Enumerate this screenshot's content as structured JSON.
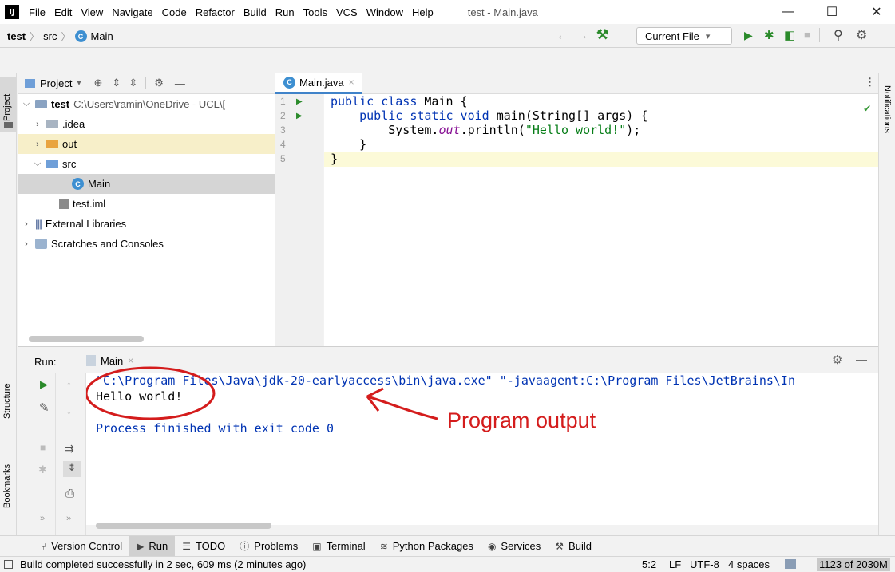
{
  "menu": {
    "items": [
      "File",
      "Edit",
      "View",
      "Navigate",
      "Code",
      "Refactor",
      "Build",
      "Run",
      "Tools",
      "VCS",
      "Window",
      "Help"
    ],
    "window_title": "test - Main.java",
    "logo_text": "IJ"
  },
  "window_controls": {
    "minimize": "—",
    "maximize": "☐",
    "close": "✕"
  },
  "breadcrumb": {
    "project": "test",
    "folder": "src",
    "file": "Main"
  },
  "run_config": {
    "label": "Current File",
    "arrow": "▾"
  },
  "side_labels": {
    "project": "Project",
    "structure": "Structure",
    "bookmarks": "Bookmarks",
    "notifications": "Notifications"
  },
  "project_panel": {
    "title": "Project",
    "tree": {
      "root_name": "test",
      "root_path": "C:\\Users\\ramin\\OneDrive - UCL\\[",
      "idea": ".idea",
      "out": "out",
      "src": "src",
      "main": "Main",
      "iml": "test.iml",
      "external": "External Libraries",
      "scratches": "Scratches and Consoles"
    }
  },
  "editor": {
    "tab_label": "Main.java",
    "line_numbers": [
      "1",
      "2",
      "3",
      "4",
      "5"
    ],
    "code": {
      "l1_kw": "public class ",
      "l1_rest": "Main {",
      "l2_kw": "    public static void ",
      "l2_rest": "main(String[] args) {",
      "l3_pre": "        System.",
      "l3_field": "out",
      "l3_mid": ".println(",
      "l3_str": "\"Hello world!\"",
      "l3_end": ");",
      "l4": "    }",
      "l5": "}"
    }
  },
  "run_panel": {
    "label": "Run:",
    "tab": "Main",
    "console": {
      "cmd": "\"C:\\Program Files\\Java\\jdk-20-earlyaccess\\bin\\java.exe\" \"-javaagent:C:\\Program Files\\JetBrains\\In",
      "output": "Hello world!",
      "exit": "Process finished with exit code 0"
    },
    "annotation": "Program output"
  },
  "tool_windows": [
    "Version Control",
    "Run",
    "TODO",
    "Problems",
    "Terminal",
    "Python Packages",
    "Services",
    "Build"
  ],
  "status": {
    "message": "Build completed successfully in 2 sec, 609 ms (2 minutes ago)",
    "position": "5:2",
    "line_sep": "LF",
    "encoding": "UTF-8",
    "indent": "4 spaces",
    "memory": "1123 of 2030M"
  },
  "colors": {
    "accent": "#4083c9",
    "annotation": "#d41c1c",
    "run_green": "#2a8a2a"
  }
}
